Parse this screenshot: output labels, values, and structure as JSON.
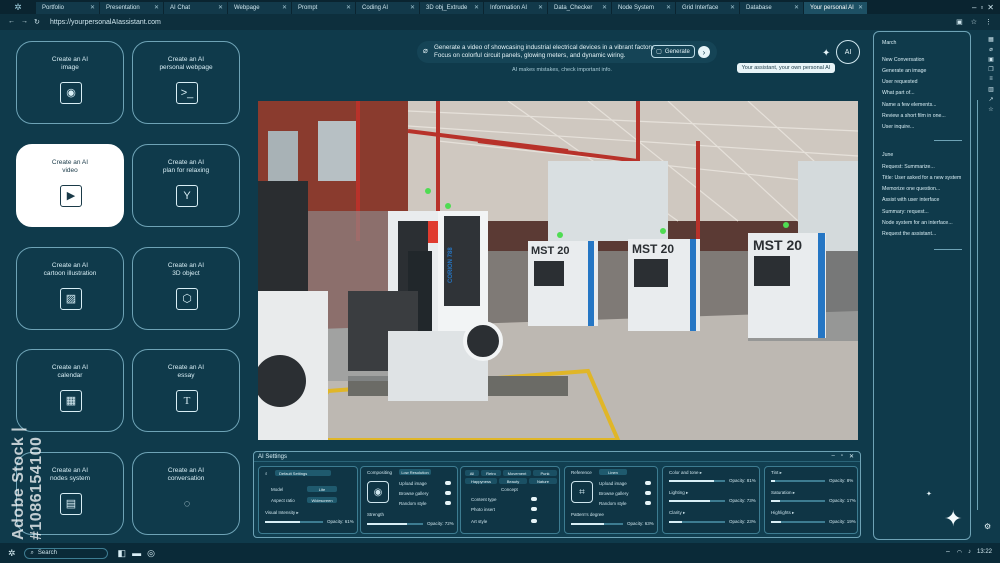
{
  "tabs": [
    {
      "label": "Portfolio"
    },
    {
      "label": "Presentation"
    },
    {
      "label": "AI Chat"
    },
    {
      "label": "Webpage"
    },
    {
      "label": "Prompt"
    },
    {
      "label": "Coding AI"
    },
    {
      "label": "3D obj_Extrude"
    },
    {
      "label": "Information AI"
    },
    {
      "label": "Data_Checker"
    },
    {
      "label": "Node System"
    },
    {
      "label": "Grid Interface"
    },
    {
      "label": "Database"
    },
    {
      "label": "Your personal AI"
    }
  ],
  "address": {
    "url": "https://yourpersonalAIassistant.com"
  },
  "cards": [
    {
      "line1": "Create an AI",
      "line2": "image"
    },
    {
      "line1": "Create an AI",
      "line2": "personal webpage"
    },
    {
      "line1": "Create an AI",
      "line2": "video"
    },
    {
      "line1": "Create an AI",
      "line2": "plan for relaxing"
    },
    {
      "line1": "Create an AI",
      "line2": "cartoon illustration"
    },
    {
      "line1": "Create an AI",
      "line2": "3D object"
    },
    {
      "line1": "Create an AI",
      "line2": "calendar"
    },
    {
      "line1": "Create an AI",
      "line2": "essay"
    },
    {
      "line1": "Create an AI",
      "line2": "nodes system"
    },
    {
      "line1": "Create an AI",
      "line2": "conversation"
    }
  ],
  "prompt": {
    "line1": "Generate a video of showcasing industrial electrical devices in a vibrant factory.",
    "line2": "Focus on colorful circuit panels, glowing meters, and dynamic wiring.",
    "generate_label": "Generate",
    "disclaimer": "AI makes mistakes, check important info.",
    "assistant_badge": "AI",
    "assistant_tip": "Your assistant, your own personal AI"
  },
  "scene": {
    "machine_labels": [
      "MST 20",
      "MST 20",
      "MST 20"
    ],
    "corion_label": "CORION 788"
  },
  "settings": {
    "title": "AI Settings",
    "panel1": {
      "search_placeholder": "Default Settings",
      "model_label": "Model",
      "model_value": "Lite",
      "aspect_label": "Aspect ratio",
      "aspect_value": "Widescreen",
      "visual_label": "Visual Intensity ▸",
      "opacity": "Opacity: 61%"
    },
    "panel2": {
      "compositing_label": "Compositing",
      "compositing_value": "Low Resolution",
      "upload": "Upload image",
      "browse": "Browse gallery",
      "random": "Random style",
      "strength": "Strength",
      "opacity": "Opacity: 72%"
    },
    "panel3": {
      "filters": [
        "All",
        "Retro",
        "Movement",
        "Punk",
        "Happyness",
        "Beauty",
        "Nature"
      ],
      "concept": "Concept",
      "content_type": "Content type",
      "photo_insert": "Photo insert",
      "art_style": "Art style"
    },
    "panel4": {
      "reference_label": "Reference",
      "reference_value": "Linen",
      "upload": "Upload image",
      "browse": "Browse gallery",
      "random": "Random style",
      "pattern": "Pattern's degree",
      "opacity": "Opacity: 63%"
    },
    "panel5": {
      "color_tone": "Color and tone ▸",
      "ct_opacity": "Opacity: 81%",
      "lighting": "Lighting ▸",
      "li_opacity": "Opacity: 73%",
      "clarity": "Clarity ▸",
      "cl_opacity": "Opacity: 23%"
    },
    "panel6": {
      "tint": "Tint ▸",
      "tint_opacity": "Opacity: 8%",
      "saturation": "Saturation ▸",
      "sat_opacity": "Opacity: 17%",
      "highlights": "Highlights ▸",
      "hi_opacity": "Opacity: 19%"
    }
  },
  "history": {
    "march": "March",
    "march_items": [
      "New Conversation",
      "Generate an image",
      "User requested",
      "What part of...",
      "Name a few elements...",
      "Review a short film in one...",
      "User inquire..."
    ],
    "june": "June",
    "june_items": [
      "Request: Summarize...",
      "Title: User asked for a new system",
      "Memorize one question...",
      "Assist with user interface",
      "Summary: request...",
      "Node system for an interface...",
      "Request the assistant..."
    ]
  },
  "taskbar": {
    "search_placeholder": "Search",
    "time": "13:22"
  },
  "watermark": "Adobe Stock | #1086154100"
}
